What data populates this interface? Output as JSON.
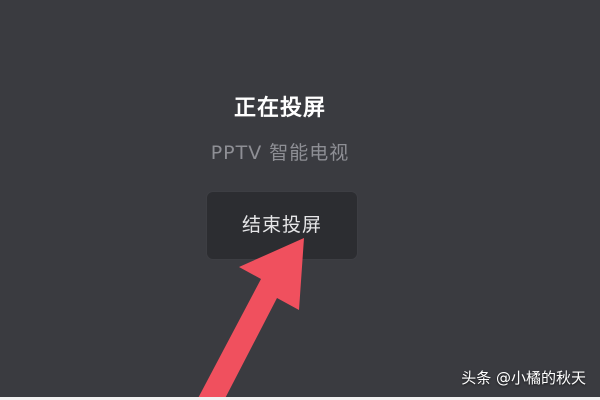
{
  "screen": {
    "title": "正在投屏",
    "device_name": "PPTV 智能电视",
    "stop_button_label": "结束投屏"
  },
  "annotation": {
    "arrow_color": "#f0505e",
    "icon": "arrow-up-right-icon"
  },
  "watermark": {
    "text": "头条 @小橘的秋天"
  },
  "colors": {
    "background": "#3a3b40",
    "button_background": "#2c2d31",
    "title_text": "#ffffff",
    "secondary_text": "#8e8f95"
  }
}
